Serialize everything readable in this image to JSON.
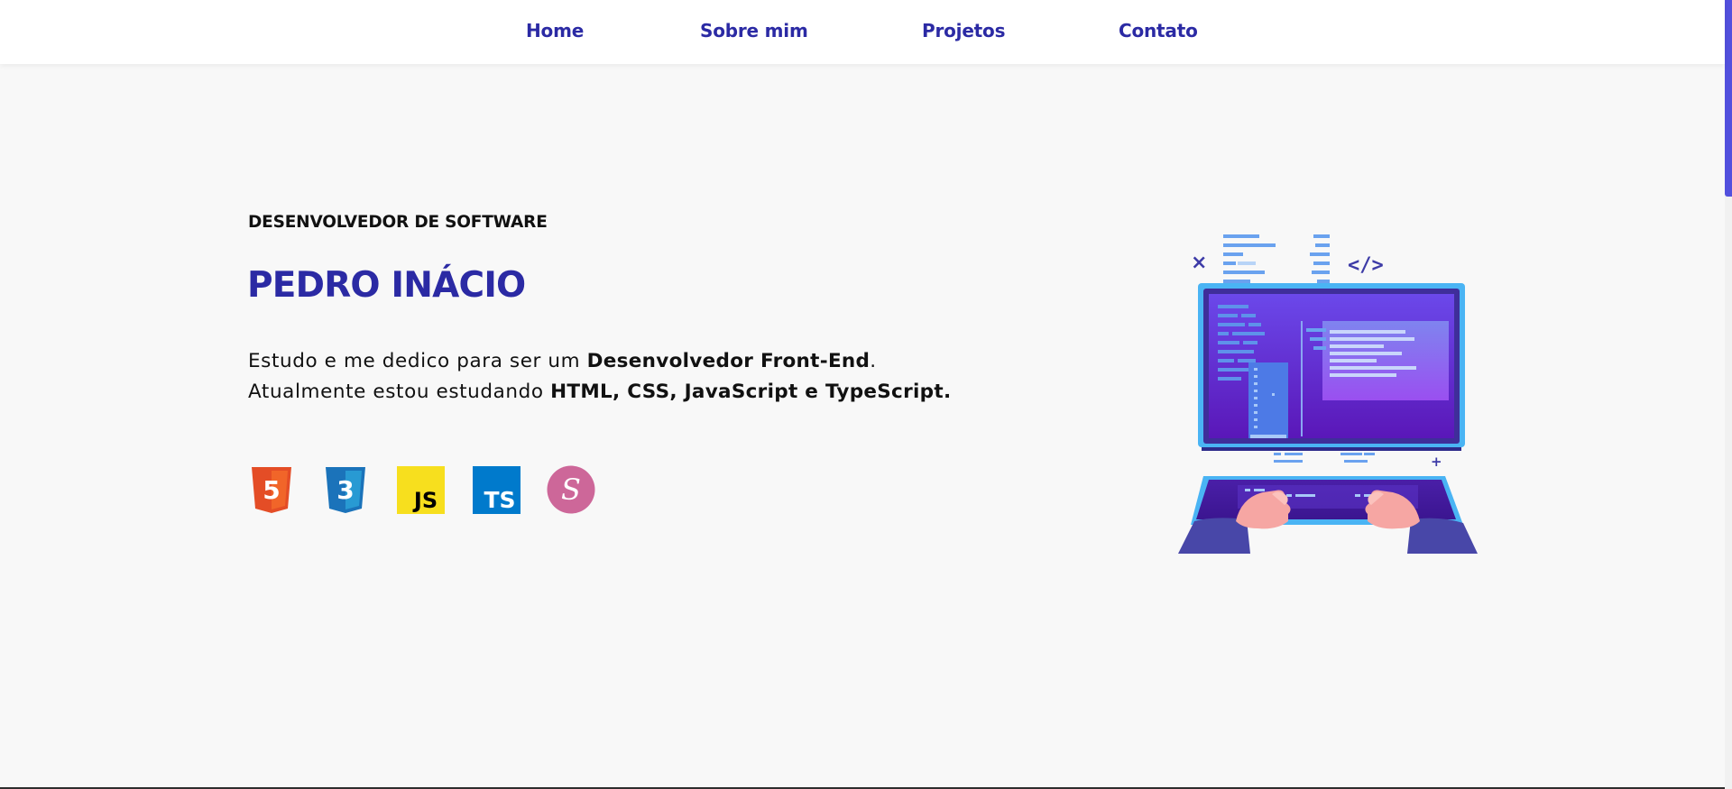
{
  "nav": {
    "items": [
      {
        "label": "Home"
      },
      {
        "label": "Sobre mim"
      },
      {
        "label": "Projetos"
      },
      {
        "label": "Contato"
      }
    ]
  },
  "hero": {
    "subtitle": "DESENVOLVEDOR DE SOFTWARE",
    "name": "PEDRO INÁCIO",
    "line1_prefix": "Estudo e me dedico para ser um ",
    "line1_bold": "Desenvolvedor Front-End",
    "line1_suffix": ".",
    "line2_prefix": "Atualmente estou estudando ",
    "line2_bold": "HTML, CSS, JavaScript e TypeScript."
  },
  "tech_icons": [
    {
      "icon": "html5-icon",
      "text": "5",
      "color": "#e44d26"
    },
    {
      "icon": "css3-icon",
      "text": "3",
      "color": "#1b73ba"
    },
    {
      "icon": "javascript-icon",
      "text": "JS",
      "color": "#f7df1e"
    },
    {
      "icon": "typescript-icon",
      "text": "TS",
      "color": "#007acc"
    },
    {
      "icon": "sass-icon",
      "text": "S",
      "color": "#cd6799"
    }
  ],
  "illustration": {
    "icon": "developer-laptop-illustration",
    "code_tag": "</>",
    "close_mark": "×",
    "plus_mark": "+"
  },
  "colors": {
    "brand": "#2b2aa4",
    "background": "#f8f8f8",
    "navbar": "#ffffff",
    "scrollbar": "#5250dd"
  }
}
